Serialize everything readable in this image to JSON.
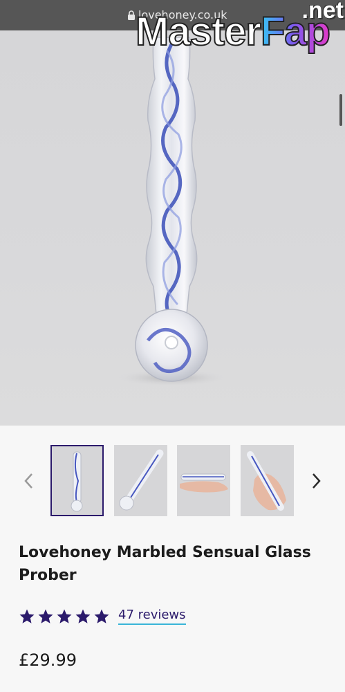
{
  "browser": {
    "url": "lovehoney.co.uk"
  },
  "watermark": {
    "brand_main": "Master",
    "brand_accent": "Fap",
    "brand_tld": ".net"
  },
  "product": {
    "title": "Lovehoney Marbled Sensual Glass Prober",
    "rating_stars": 5,
    "reviews_label": "47 reviews",
    "price": "£29.99"
  },
  "gallery": {
    "thumbnail_count": 4,
    "selected_index": 0,
    "thumbnails": [
      "upright-glass",
      "angled-glass",
      "glass-on-palm",
      "glass-in-hand"
    ]
  },
  "colors": {
    "accent": "#2b1a6b",
    "underline": "#39b4d8",
    "image_bg": "#d6d6d8"
  }
}
